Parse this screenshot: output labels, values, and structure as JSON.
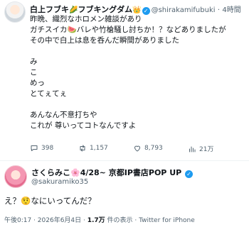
{
  "tweet1": {
    "display_name": "白上フブキ",
    "name_emoji1": "🌽",
    "display_name2": "フブキングダム",
    "name_emoji2": "👑",
    "handle": "@shirakamifubuki",
    "dot": "·",
    "time": "4時間",
    "lines": [
      "昨晩、織烈なホロメン雑談があり",
      "ガチスイカ🍉バレや竹槍騒し討ちか！？などありましたが",
      "その中で白上は息を呑んだ瞬間がありました",
      "",
      "み",
      "こ",
      "めっ",
      "とてぇてぇ",
      "",
      "あんなん不意打ちや",
      "これが 尊いってコトなんですよ"
    ],
    "actions": {
      "replies": "398",
      "retweets": "1,157",
      "likes": "8,793",
      "views": "21万"
    }
  },
  "tweet2": {
    "display_name": "さくらみこ",
    "name_emoji": "🌸",
    "name_suffix": "4/28~ 京都IP書店POP UP",
    "handle": "@sakuramiko35",
    "text": "え？🤨なにいってんだ？",
    "meta_time": "午後0:17 · 2026年6月4日 · ",
    "meta_views": "1.7万",
    "meta_views_label": " 件の表示 · Twitter for iPhone"
  },
  "colors": {
    "verified": "#1d9bf0",
    "secondary_text": "#536471",
    "primary_text": "#0f1419",
    "divider": "#eff3f4"
  },
  "icons": {
    "reply": "comment-icon",
    "retweet": "retweet-icon",
    "like": "heart-icon",
    "views": "views-icon",
    "verified": "verified-badge-icon"
  }
}
